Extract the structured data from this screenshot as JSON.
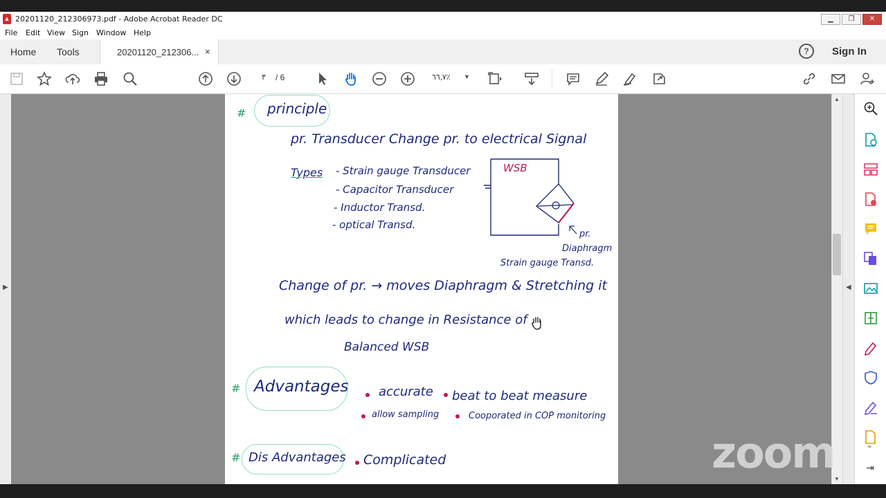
{
  "window": {
    "title": "20201120_212306973.pdf - Adobe Acrobat Reader DC",
    "app_icon": "pdf-icon",
    "controls": [
      "minimize",
      "restore",
      "close"
    ]
  },
  "menu": [
    "File",
    "Edit",
    "View",
    "Sign",
    "Window",
    "Help"
  ],
  "tabs": {
    "home": "Home",
    "tools": "Tools",
    "document": "20201120_212306...",
    "close_glyph": "×",
    "help_glyph": "?",
    "sign_in": "Sign In"
  },
  "toolbar": {
    "current_page": "٣",
    "page_total": "/ 6",
    "zoom": "٦٦,٧٪",
    "icons": [
      "save-icon",
      "bookmark-star-icon",
      "upload-cloud-icon",
      "print-icon",
      "find-zoom-icon",
      "page-up-icon",
      "page-down-icon",
      "select-cursor-icon",
      "hand-pan-icon",
      "zoom-out-icon",
      "zoom-in-icon",
      "fit-page-icon",
      "scroll-mode-icon",
      "comment-icon",
      "highlight-pen-icon",
      "sign-icon",
      "share-edit-icon",
      "link-icon",
      "mail-icon",
      "add-user-icon"
    ]
  },
  "right_panel_icons": [
    "zoom-search-icon",
    "export-pdf-icon",
    "organize-pages-icon",
    "create-pdf-icon",
    "comment-tool-icon",
    "combine-files-icon",
    "export-image-icon",
    "compress-icon",
    "fill-sign-icon",
    "protect-icon",
    "edit-pen-icon",
    "more-tools-icon"
  ],
  "accent_color": "#1473e6",
  "page_content": {
    "heading_principle": "principle",
    "line_transducer": "pr. Transducer  Change pr. to electrical Signal",
    "types_label": "Types",
    "types": [
      "- Strain gauge Transducer",
      "- Capacitor Transducer",
      "- Inductor Transd.",
      "- optical Transd."
    ],
    "diagram_wsb": "WSB",
    "diagram_pr": "pr.",
    "diagram_diaphragm": "Diaphragm",
    "diagram_caption": "Strain gauge Transd.",
    "line_change": "Change of pr. → moves Diaphragm & Stretching it",
    "line_which": "which leads to change in Resistance of",
    "line_balanced": "Balanced   WSB",
    "heading_advantages": "Advantages",
    "adv_1": "accurate",
    "adv_2": "beat to beat measure",
    "adv_3": "allow sampling",
    "adv_4": "Cooporated in COP monitoring",
    "heading_disadvantages": "Dis Advantages",
    "disadv_1": "Complicated"
  },
  "watermark": "zoom"
}
